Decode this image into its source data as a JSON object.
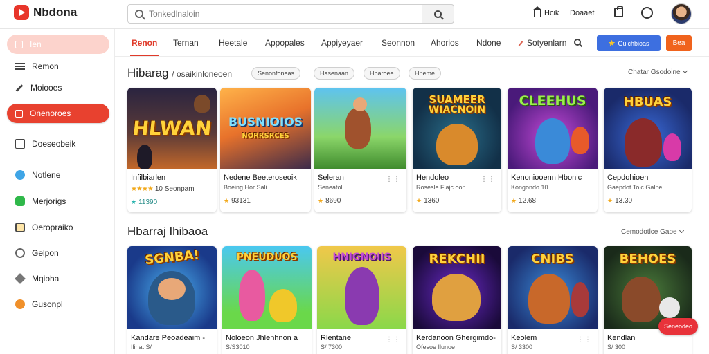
{
  "app": {
    "name": "Nbdona"
  },
  "search": {
    "placeholder": "Tonkedlnaloin"
  },
  "header": {
    "link1": "Hcik",
    "link2": "Doaaet"
  },
  "sidebar": {
    "items": [
      {
        "label": "Ien"
      },
      {
        "label": "Remon"
      },
      {
        "label": "Moiooes"
      },
      {
        "label": "Onenoroes"
      },
      {
        "label": "Doeseobeik"
      },
      {
        "label": "Notlene"
      },
      {
        "label": "Merjorigs"
      },
      {
        "label": "Oeropraiko"
      },
      {
        "label": "Gelpon"
      },
      {
        "label": "Mqioha"
      },
      {
        "label": "Gusonpl"
      }
    ]
  },
  "tabs": [
    {
      "label": "Renon"
    },
    {
      "label": "Ternan"
    },
    {
      "label": "Heetale"
    },
    {
      "label": "Appopales"
    },
    {
      "label": "Appiyeyaer"
    },
    {
      "label": "Seonnon"
    },
    {
      "label": "Ahorios"
    },
    {
      "label": "Ndone"
    },
    {
      "label": "Sotyenlarn"
    }
  ],
  "promo_button": "Guichbioas",
  "orange_button": "Bea",
  "section1": {
    "title": "Hibarag",
    "subtitle": "/ osaikinloneoen",
    "chips": [
      "Senonfoneas",
      "Hasenaan",
      "Hbaroee",
      "Hneme"
    ],
    "more": "Chatar Gsodoine",
    "cards": [
      {
        "thumb_title1": "HLWAN",
        "thumb_title2": "BUSNIOIOS",
        "thumb_title3": "NORRSRCES",
        "name": "Infilbiarlen",
        "sub": "",
        "meta": "10 Seonpam",
        "rating_style": "stars"
      },
      {
        "name": "Nedene Beeteroseoik",
        "sub": "Boeing Hor Sali",
        "meta": "93131",
        "rating_style": "dot"
      },
      {
        "name": "Seleran",
        "sub": "Seneatol",
        "meta": "8690",
        "rating_style": "dot"
      },
      {
        "thumb_title1": "SUAMEER",
        "thumb_title2": "WIACNOIN",
        "name": "Hendoleo",
        "sub": "Rosesle Fiajc oon",
        "meta": "1360",
        "rating_style": "dot"
      },
      {
        "thumb_title1": "CLEEHUS",
        "name": "Kenoniooenn Hbonic",
        "sub": "Kongondo 10",
        "meta": "12.68",
        "rating_style": "dot2"
      },
      {
        "thumb_title1": "HBUAS",
        "name": "Cepdohioen",
        "sub": "Gaepdot Tolc Galne",
        "meta": "13.30",
        "rating_style": "dot2"
      }
    ],
    "card1_rating": "★★★★",
    "card1_teal": "11390"
  },
  "section2": {
    "title": "Hbarraj Ihibaoa",
    "more": "Cemodotlce Gaoe",
    "cards": [
      {
        "thumb_title1": "SGNBA!",
        "name": "Kandare Peoadeaim -",
        "sub": "Ilihat S/"
      },
      {
        "thumb_title1": "PNEUDUOS",
        "name": "Noloeon Jhlenhnon a",
        "sub": "S/S3010"
      },
      {
        "thumb_title1": "HNIGNOIIS",
        "name": "Rlentane",
        "sub": "S/ 7300"
      },
      {
        "thumb_title1": "REKCHII",
        "name": "Kerdanoon Ghergimdo-",
        "sub": "Ofesoe Ilunoe"
      },
      {
        "thumb_title1": "CNIBS",
        "name": "Keolem",
        "sub": "S/ 3300"
      },
      {
        "thumb_title1": "BEHOES",
        "name": "Kendlan",
        "sub": "S/ 300"
      }
    ]
  },
  "fab": "Seneodeo"
}
